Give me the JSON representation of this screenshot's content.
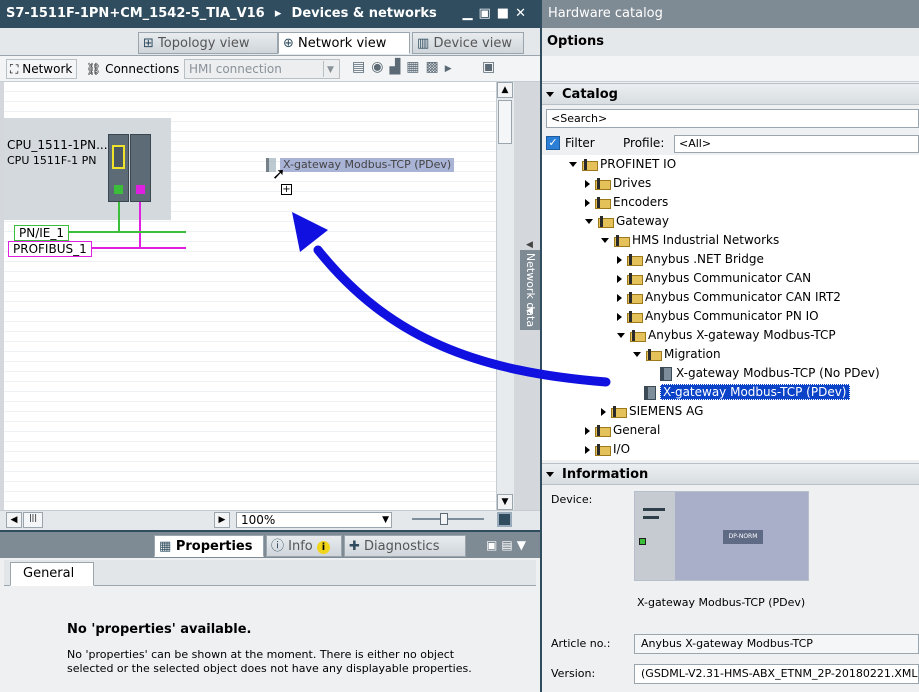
{
  "left": {
    "title": "S7-1511F-1PN+CM_1542-5_TIA_V16",
    "breadcrumb_sep": "▸",
    "breadcrumb": "Devices & networks",
    "tabs": [
      "Topology view",
      "Network view",
      "Device view"
    ],
    "toolbar": {
      "network": "Network",
      "connections": "Connections",
      "connection_type": "HMI connection"
    },
    "cpu": {
      "name": "CPU_1511-1PN...",
      "model": "CPU 1511F-1 PN"
    },
    "dragged_device": "X-gateway Modbus-TCP (PDev)",
    "subnets": [
      "PN/IE_1",
      "PROFIBUS_1"
    ],
    "network_data_label": "Network data",
    "zoom": "100%"
  },
  "bottom": {
    "tabs": [
      "Properties",
      "Info",
      "Diagnostics"
    ],
    "info_badge": "i",
    "subtab": "General",
    "heading": "No 'properties' available.",
    "message_line1": "No 'properties' can be shown at the moment. There is either no object",
    "message_line2": "selected or the selected object does not have any displayable properties."
  },
  "right": {
    "title": "Hardware catalog",
    "options": "Options",
    "catalog_header": "Catalog",
    "search_placeholder": "<Search>",
    "filter_label": "Filter",
    "profile_label": "Profile:",
    "profile_value": "<All>",
    "tree": [
      "PROFINET IO",
      "Drives",
      "Encoders",
      "Gateway",
      "HMS Industrial Networks",
      "Anybus .NET Bridge",
      "Anybus Communicator CAN",
      "Anybus Communicator CAN IRT2",
      "Anybus Communicator PN IO",
      "Anybus X-gateway Modbus-TCP",
      "Migration",
      "X-gateway Modbus-TCP (No PDev)",
      "X-gateway Modbus-TCP (PDev)",
      "SIEMENS AG",
      "General",
      "I/O"
    ],
    "info_header": "Information",
    "device_label": "Device:",
    "device_image_text": "DP-NORM",
    "device_name": "X-gateway Modbus-TCP (PDev)",
    "article_label": "Article no.:",
    "article_value": "Anybus X-gateway Modbus-TCP",
    "version_label": "Version:",
    "version_value": "(GSDML-V2.31-HMS-ABX_ETNM_2P-20180221.XML)"
  },
  "colors": {
    "titlebar": "#2f4d5f",
    "selection": "#0a43c8",
    "profinet": "#3bbf3b",
    "profibus": "#e020e0",
    "arrow": "#1010e0"
  }
}
